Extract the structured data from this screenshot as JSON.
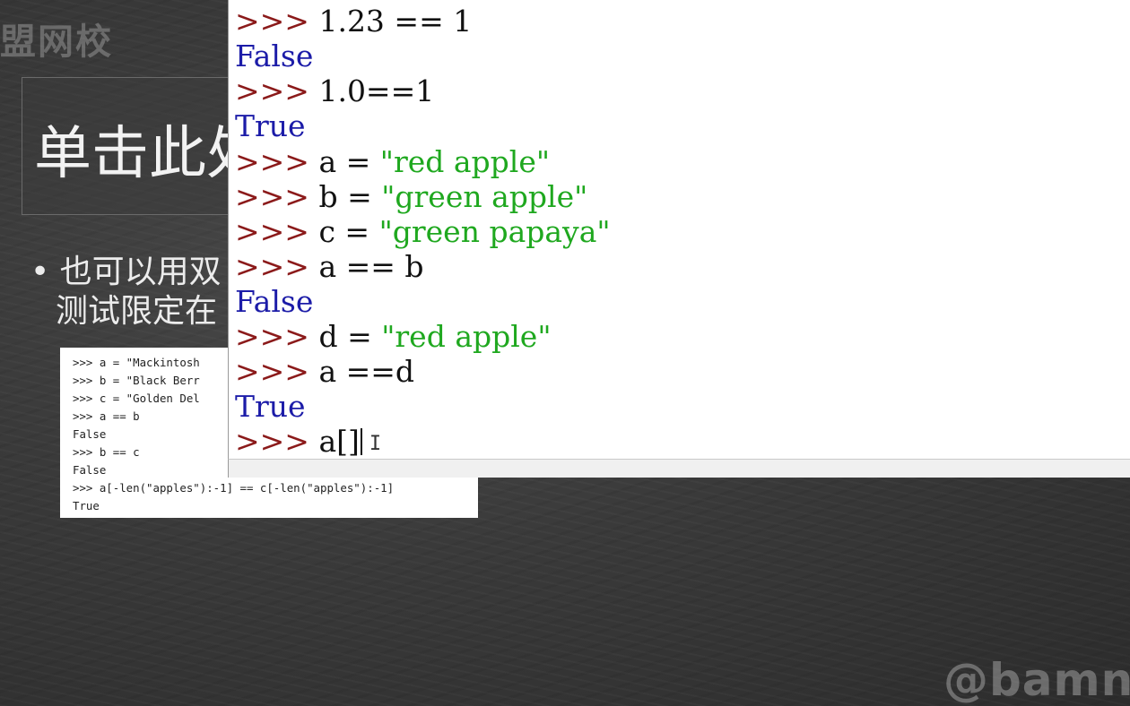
{
  "slide": {
    "watermark_top": "盟网校",
    "title": "单击此处",
    "bullet_line1": "• 也可以用双",
    "bullet_line2": "测试限定在",
    "code_image_lines": [
      ">>> a = \"Mackintosh",
      ">>> b = \"Black Berr",
      ">>> c = \"Golden Del",
      ">>> a == b",
      "False",
      ">>> b == c",
      "False",
      ">>> a[-len(\"apples\"):-1] == c[-len(\"apples\"):-1]",
      "True"
    ],
    "watermark_bottom": "@bamn."
  },
  "shell": {
    "prompt": ">>>",
    "lines": [
      {
        "code": "1.23 == 1"
      },
      {
        "output": "False"
      },
      {
        "code": "1.0==1"
      },
      {
        "output": "True"
      },
      {
        "code": "a = ",
        "string": "\"red apple\""
      },
      {
        "code": "b = ",
        "string": "\"green apple\""
      },
      {
        "code": "c = ",
        "string": "\"green papaya\""
      },
      {
        "code": "a == b"
      },
      {
        "output": "False"
      },
      {
        "code": "d = ",
        "string": "\"red apple\""
      },
      {
        "code": "a ==d"
      },
      {
        "output": "True"
      },
      {
        "code": "a[]",
        "current": true
      }
    ]
  },
  "colors": {
    "prompt": "#8b1a1a",
    "string": "#1fa81f",
    "output": "#1c1ca8"
  }
}
